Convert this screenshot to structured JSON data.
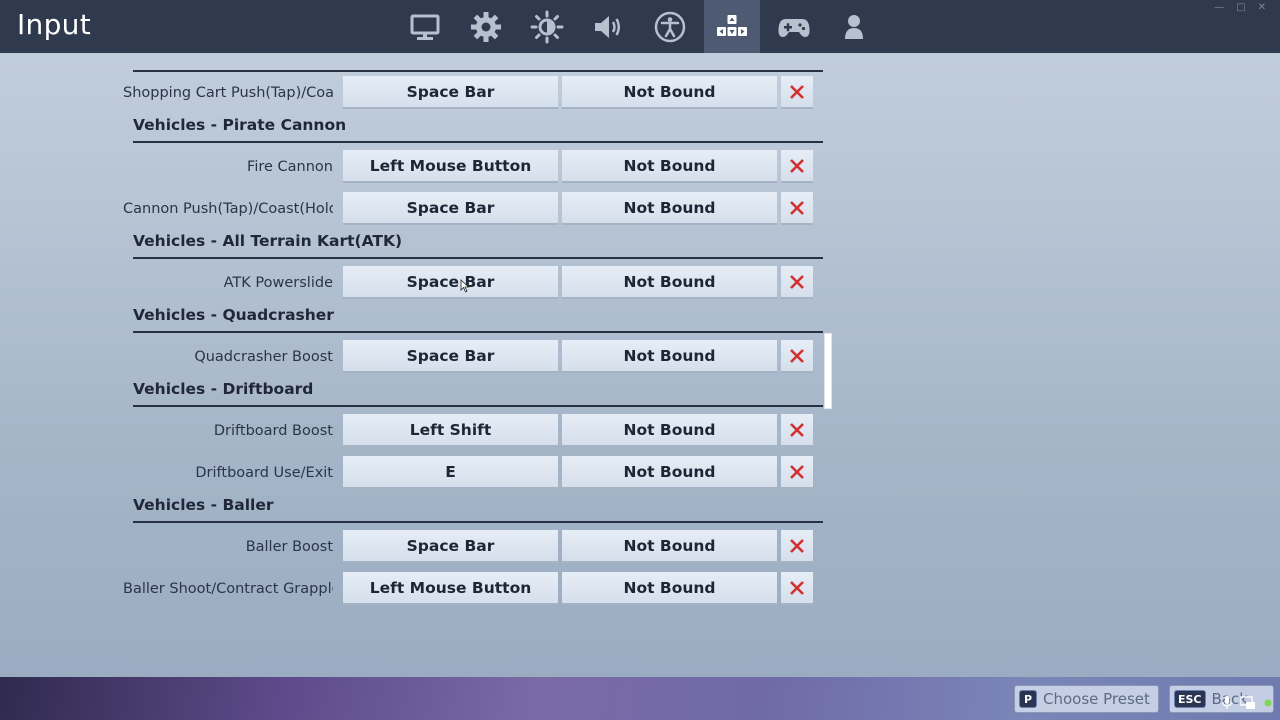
{
  "header": {
    "title": "Input",
    "tabs": [
      {
        "name": "display",
        "icon": "monitor-icon"
      },
      {
        "name": "game",
        "icon": "gear-icon"
      },
      {
        "name": "brightness",
        "icon": "sun-icon"
      },
      {
        "name": "audio",
        "icon": "speaker-icon"
      },
      {
        "name": "accessibility",
        "icon": "accessibility-icon"
      },
      {
        "name": "input",
        "icon": "keyboard-keys-icon",
        "active": true
      },
      {
        "name": "controller",
        "icon": "gamepad-icon"
      },
      {
        "name": "account",
        "icon": "person-icon"
      }
    ],
    "window_controls": [
      "—",
      "□",
      "✕"
    ]
  },
  "bindings": {
    "rows": [
      {
        "label": "Shopping Cart Push(Tap)/Coas",
        "primary": "Space Bar",
        "secondary": "Not Bound"
      },
      {
        "label": "Fire Cannon",
        "primary": "Left Mouse Button",
        "secondary": "Not Bound"
      },
      {
        "label": "Cannon Push(Tap)/Coast(Hold)",
        "primary": "Space Bar",
        "secondary": "Not Bound"
      },
      {
        "label": "ATK Powerslide",
        "primary": "Space Bar",
        "secondary": "Not Bound"
      },
      {
        "label": "Quadcrasher Boost",
        "primary": "Space Bar",
        "secondary": "Not Bound"
      },
      {
        "label": "Driftboard Boost",
        "primary": "Left Shift",
        "secondary": "Not Bound"
      },
      {
        "label": "Driftboard Use/Exit",
        "primary": "E",
        "secondary": "Not Bound"
      },
      {
        "label": "Baller Boost",
        "primary": "Space Bar",
        "secondary": "Not Bound"
      },
      {
        "label": "Baller Shoot/Contract Grapple",
        "primary": "Left Mouse Button",
        "secondary": "Not Bound"
      }
    ],
    "sections": [
      "Vehicles - Pirate Cannon",
      "Vehicles - All Terrain Kart(ATK)",
      "Vehicles - Quadcrasher",
      "Vehicles - Driftboard",
      "Vehicles - Baller"
    ],
    "clear_icon": "close-icon",
    "clear_color": "#d32f2f"
  },
  "footer": {
    "preset_key": "P",
    "preset_label": "Choose Preset",
    "back_key": "ESC",
    "back_label": "Back"
  },
  "colors": {
    "topbar": "#303a4e",
    "active_tab": "#4d5a72",
    "button_face": "#dde6f1"
  }
}
